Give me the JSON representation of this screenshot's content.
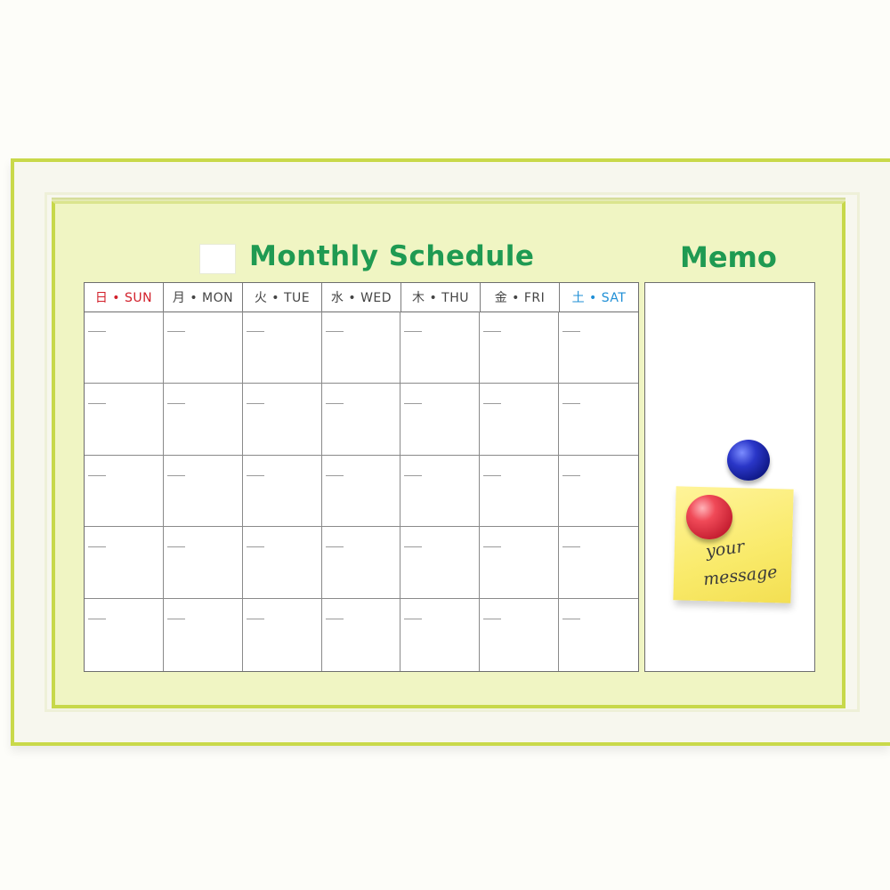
{
  "board": {
    "title": "Monthly Schedule",
    "memo_title": "Memo"
  },
  "calendar": {
    "days": [
      {
        "label": "日 • SUN",
        "tone": "sun"
      },
      {
        "label": "月 • MON",
        "tone": "weekday"
      },
      {
        "label": "火 • TUE",
        "tone": "weekday"
      },
      {
        "label": "水 • WED",
        "tone": "weekday"
      },
      {
        "label": "木 • THU",
        "tone": "weekday"
      },
      {
        "label": "金 • FRI",
        "tone": "weekday"
      },
      {
        "label": "土 • SAT",
        "tone": "sat"
      }
    ],
    "weeks": 5
  },
  "memo": {
    "sticky_line1": "your",
    "sticky_line2": "message"
  },
  "colors": {
    "title_green": "#1f9a52",
    "frame_lime": "#c9d94a",
    "board_fill": "#f0f5c3",
    "sunday_red": "#d21f2a",
    "saturday_blue": "#1f8fd6",
    "sticky_yellow": "#f9ea6a",
    "magnet_blue": "#2a36c8",
    "magnet_red": "#f04a58"
  }
}
